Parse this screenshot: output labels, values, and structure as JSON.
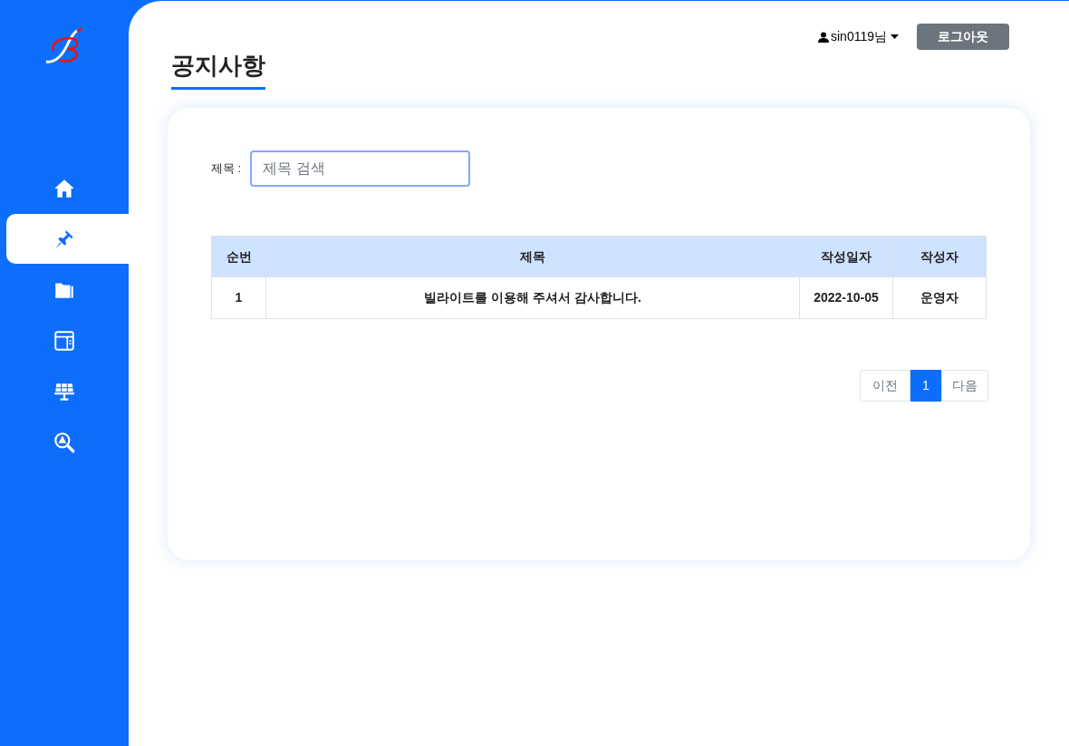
{
  "sidebar": {
    "items": [
      {
        "kind": "home",
        "selected": false
      },
      {
        "kind": "pin",
        "selected": true
      },
      {
        "kind": "folder",
        "selected": false
      },
      {
        "kind": "window",
        "selected": false
      },
      {
        "kind": "solar",
        "selected": false
      },
      {
        "kind": "alert-search",
        "selected": false
      }
    ]
  },
  "header": {
    "user": "sin0119님",
    "logout": "로그아웃"
  },
  "page_title": "공지사항",
  "search": {
    "label": "제목 :",
    "placeholder": "제목 검색"
  },
  "table": {
    "columns": [
      "순번",
      "제목",
      "작성일자",
      "작성자"
    ],
    "rows": [
      [
        "1",
        "빌라이트를 이용해 주셔서 감사합니다.",
        "2022-10-05",
        "운영자"
      ]
    ]
  },
  "pagination": {
    "prev": "이전",
    "pages": [
      {
        "label": "1",
        "selected": true
      }
    ],
    "next": "다음"
  }
}
